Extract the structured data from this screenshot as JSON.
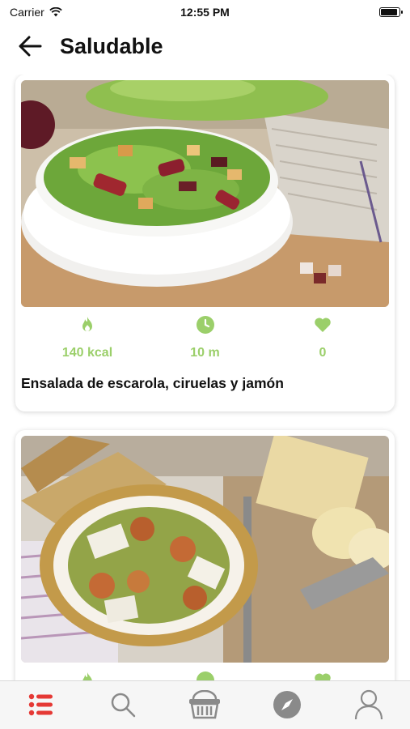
{
  "status_bar": {
    "carrier": "Carrier",
    "time": "12:55 PM"
  },
  "header": {
    "title": "Saludable"
  },
  "recipes": [
    {
      "calories": "140 kcal",
      "time": "10 m",
      "likes": "0",
      "title": "Ensalada de escarola, ciruelas y jamón"
    },
    {
      "calories": "",
      "time": "",
      "likes": "",
      "title": ""
    }
  ],
  "colors": {
    "accent_green": "#9bcf6a",
    "tab_active": "#e53935",
    "tab_inactive": "#8a8a8a"
  },
  "tab_bar": {
    "items": [
      "list-icon",
      "search-icon",
      "basket-icon",
      "compass-icon",
      "profile-icon"
    ],
    "active": "list-icon"
  }
}
